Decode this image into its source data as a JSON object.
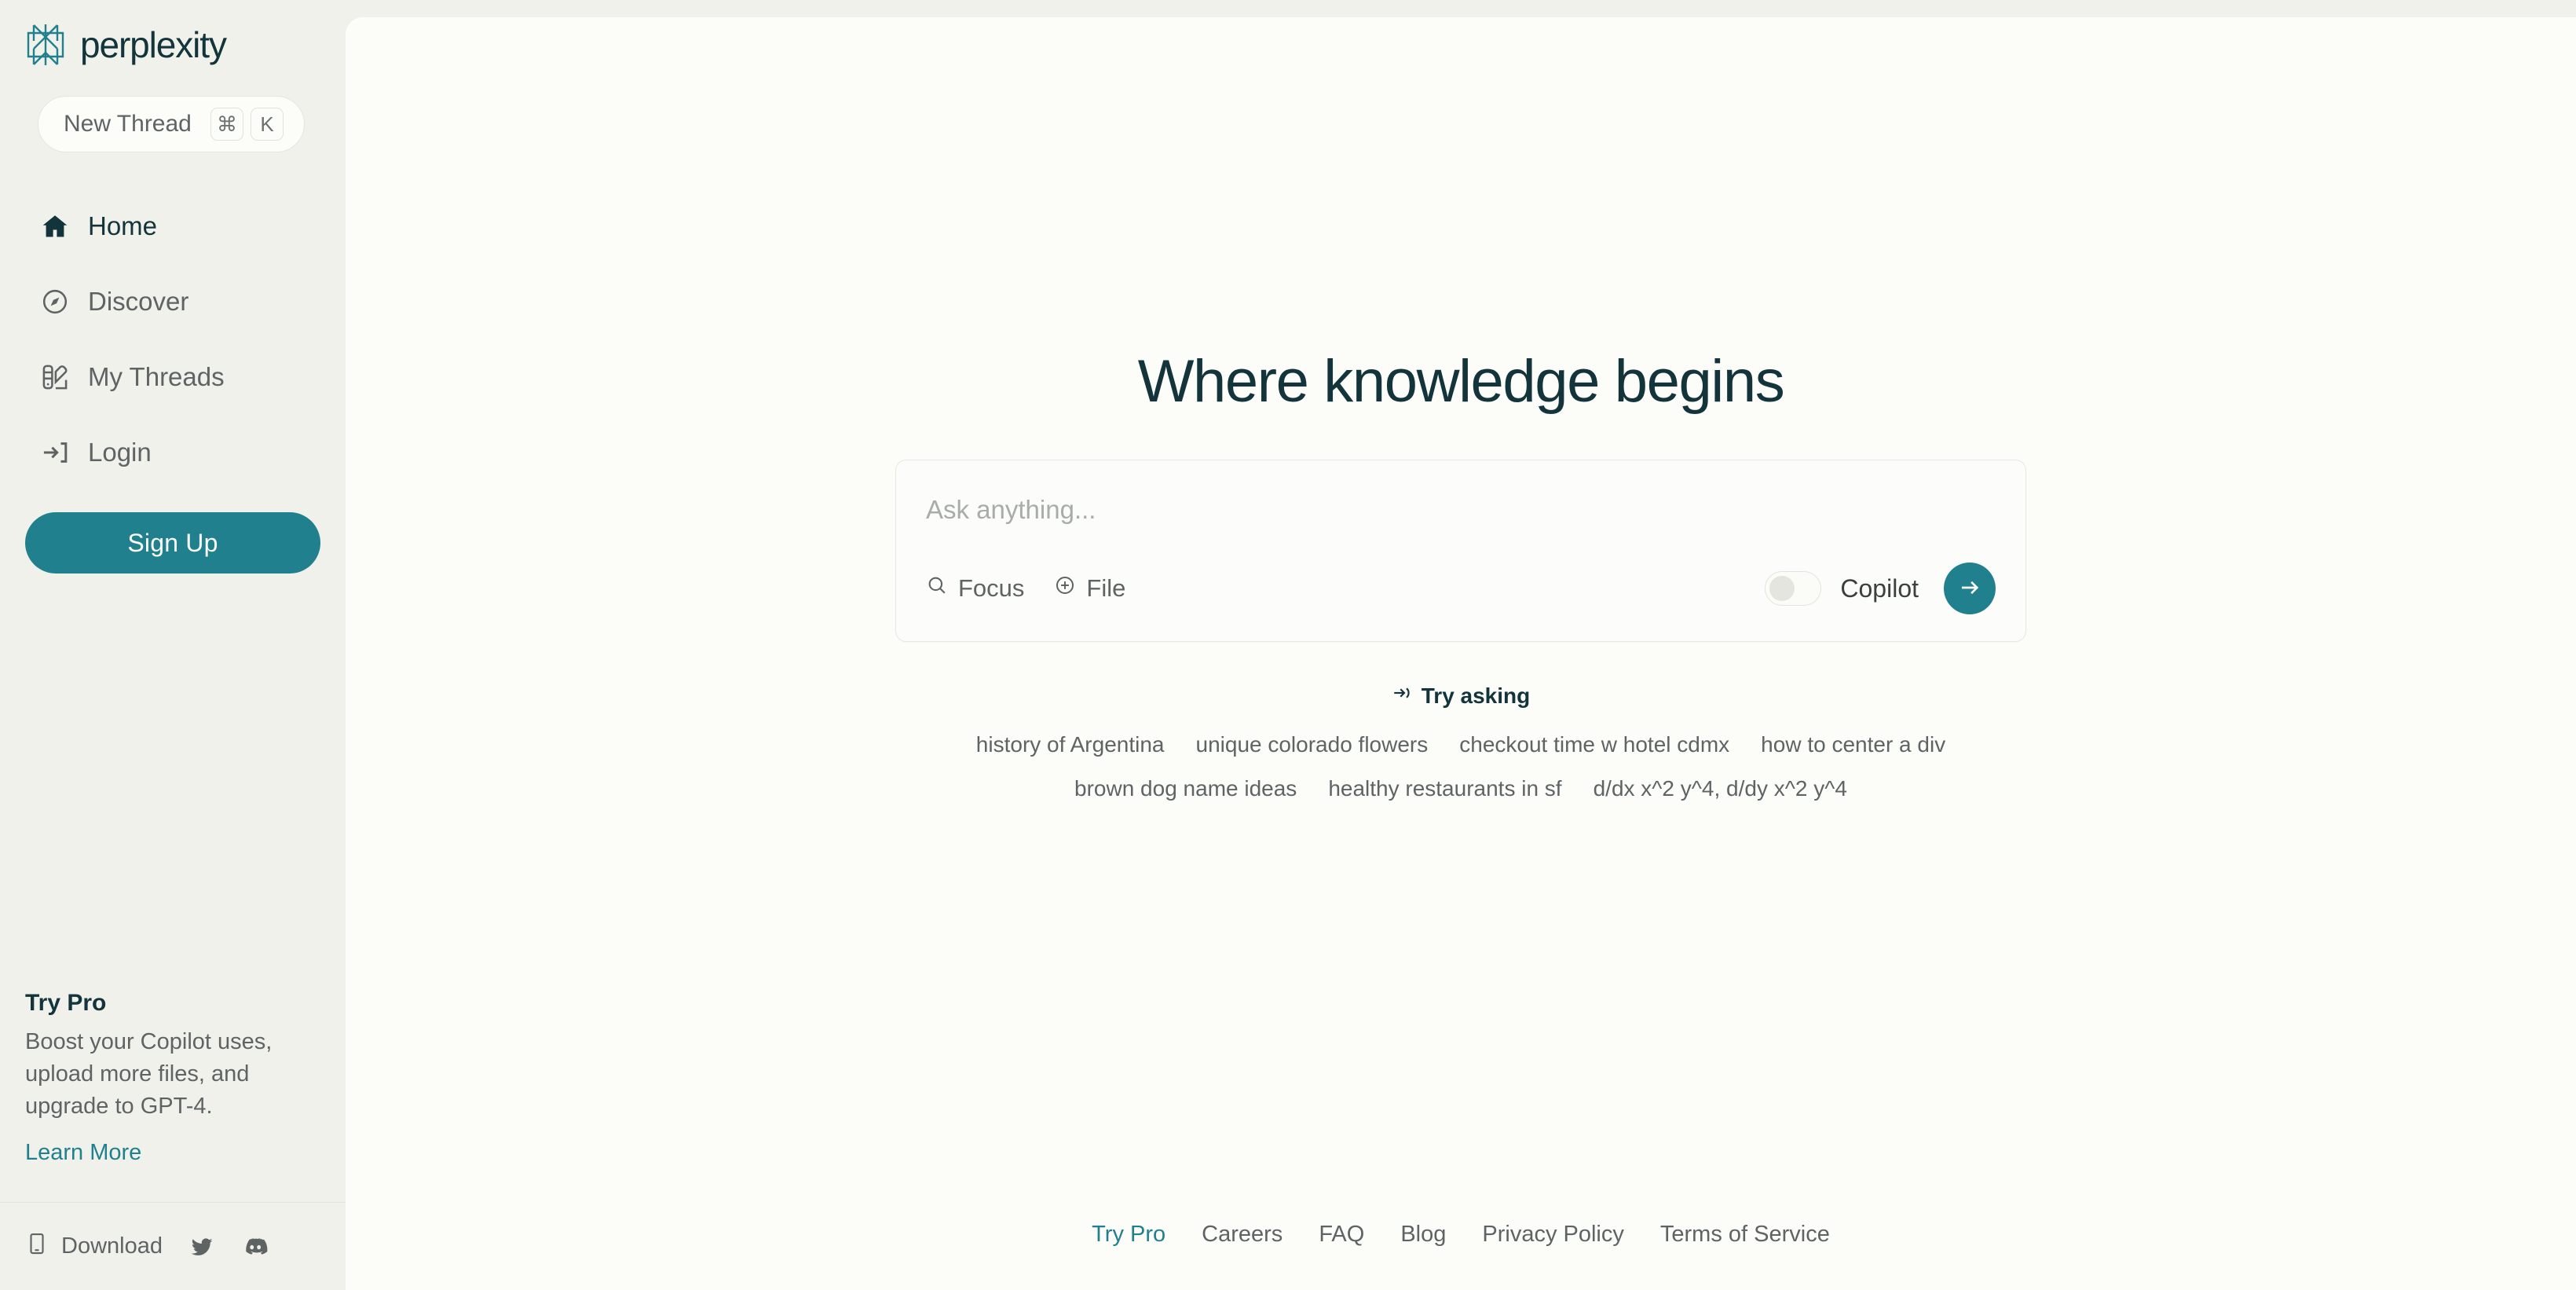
{
  "brand": {
    "name": "perplexity",
    "logo_icon": "perplexity-logo-mark",
    "accent_color": "#20808D",
    "dark_color": "#13343B",
    "sidebar_bg": "#F1F1EC",
    "main_bg": "#FCFCF9"
  },
  "sidebar": {
    "new_thread": {
      "label": "New Thread",
      "shortcut_keys": [
        "⌘",
        "K"
      ]
    },
    "nav_items": [
      {
        "label": "Home",
        "icon": "home-icon",
        "active": true
      },
      {
        "label": "Discover",
        "icon": "compass-icon",
        "active": false
      },
      {
        "label": "My Threads",
        "icon": "threads-icon",
        "active": false
      },
      {
        "label": "Login",
        "icon": "login-arrow-icon",
        "active": false
      }
    ],
    "signup_label": "Sign Up",
    "promo": {
      "title": "Try Pro",
      "description": "Boost your Copilot uses, upload more files, and upgrade to GPT-4.",
      "link_label": "Learn More"
    },
    "bottom": {
      "download_label": "Download",
      "download_icon": "phone-icon",
      "socials": [
        {
          "name": "twitter-icon"
        },
        {
          "name": "discord-icon"
        }
      ]
    }
  },
  "main": {
    "hero_title": "Where knowledge begins",
    "ask": {
      "placeholder": "Ask anything...",
      "value": "",
      "focus_label": "Focus",
      "focus_icon": "search-icon",
      "file_label": "File",
      "file_icon": "plus-circle-icon",
      "copilot_label": "Copilot",
      "copilot_enabled": false,
      "submit_icon": "arrow-right-icon"
    },
    "try_asking": {
      "label": "Try asking",
      "icon": "arrow-right-dashed-icon"
    },
    "suggestions": [
      [
        "history of Argentina",
        "unique colorado flowers",
        "checkout time w hotel cdmx",
        "how to center a div"
      ],
      [
        "brown dog name ideas",
        "healthy restaurants in sf",
        "d/dx x^2 y^4, d/dy x^2 y^4"
      ]
    ],
    "footer_links": [
      {
        "label": "Try Pro",
        "accent": true
      },
      {
        "label": "Careers",
        "accent": false
      },
      {
        "label": "FAQ",
        "accent": false
      },
      {
        "label": "Blog",
        "accent": false
      },
      {
        "label": "Privacy Policy",
        "accent": false
      },
      {
        "label": "Terms of Service",
        "accent": false
      }
    ]
  }
}
